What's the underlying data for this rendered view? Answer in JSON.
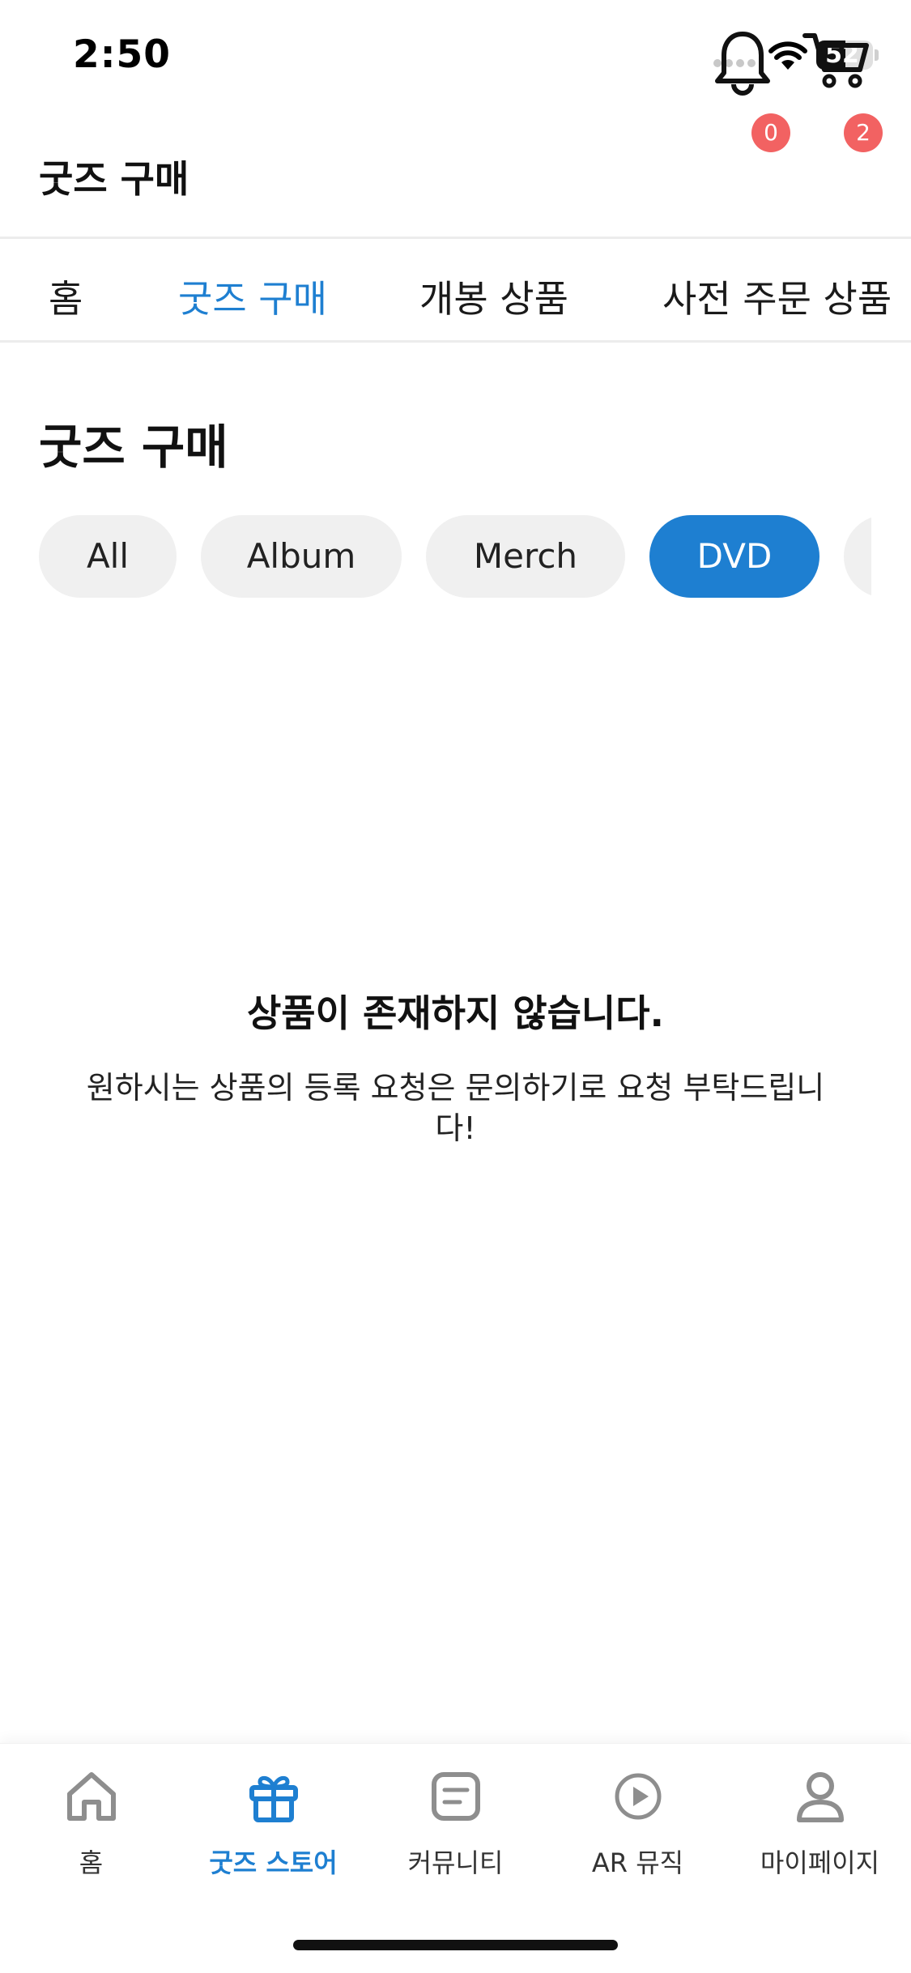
{
  "status_bar": {
    "time": "2:50",
    "battery": "52",
    "battery_level": 0.52
  },
  "header": {
    "title": "굿즈 구매",
    "notification_count": "0",
    "cart_count": "2"
  },
  "tabs": [
    {
      "label": "홈",
      "active": false
    },
    {
      "label": "굿즈 구매",
      "active": true
    },
    {
      "label": "개봉 상품",
      "active": false
    },
    {
      "label": "사전 주문 상품",
      "active": false
    }
  ],
  "section": {
    "title": "굿즈 구매"
  },
  "chips": [
    {
      "label": "All",
      "active": false
    },
    {
      "label": "Album",
      "active": false
    },
    {
      "label": "Merch",
      "active": false
    },
    {
      "label": "DVD",
      "active": true
    }
  ],
  "empty_state": {
    "title": "상품이 존재하지 않습니다.",
    "description": "원하시는 상품의 등록 요청은 문의하기로 요청 부탁드립니다!"
  },
  "bottom_nav": [
    {
      "label": "홈",
      "icon": "home-icon",
      "active": false
    },
    {
      "label": "굿즈 스토어",
      "icon": "gift-icon",
      "active": true
    },
    {
      "label": "커뮤니티",
      "icon": "community-icon",
      "active": false
    },
    {
      "label": "AR 뮤직",
      "icon": "play-circle-icon",
      "active": false
    },
    {
      "label": "마이페이지",
      "icon": "person-icon",
      "active": false
    }
  ],
  "colors": {
    "accent": "#1e7fd1",
    "badge": "#f26262",
    "chip_bg": "#f0f0f0",
    "inactive_icon": "#8e8e8e"
  }
}
